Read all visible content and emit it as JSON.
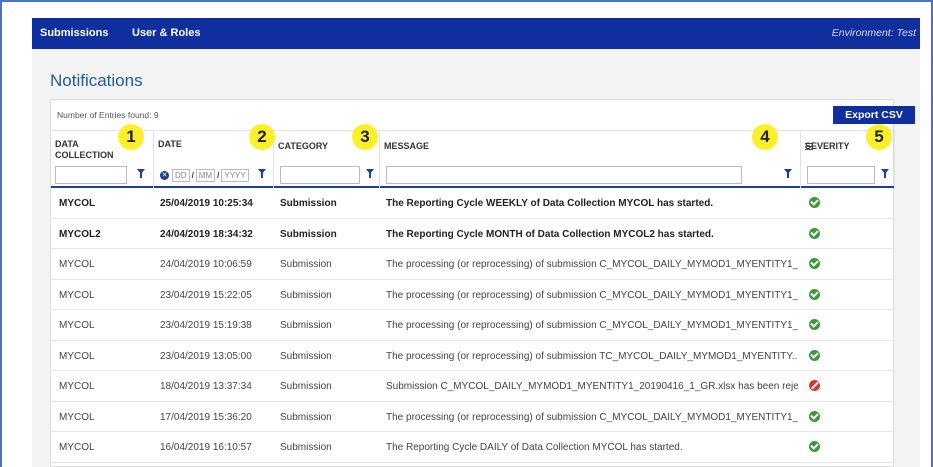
{
  "nav": {
    "items": [
      "Submissions",
      "User & Roles"
    ],
    "environment": "Environment: Test"
  },
  "page": {
    "title": "Notifications"
  },
  "table": {
    "entries_found": "Number of Entries found: 9",
    "export_label": "Export CSV",
    "columns": [
      "DATA COLLECTION",
      "DATE",
      "CATEGORY",
      "MESSAGE",
      "SEVERITY"
    ],
    "date_filter": {
      "dd": "DD",
      "mm": "MM",
      "yyyy": "YYYY"
    },
    "rows": [
      {
        "collection": "MYCOL",
        "date": "25/04/2019 10:25:34",
        "category": "Submission",
        "message": "The Reporting Cycle WEEKLY of Data Collection MYCOL has started.",
        "severity": "ok",
        "bold": true
      },
      {
        "collection": "MYCOL2",
        "date": "24/04/2019 18:34:32",
        "category": "Submission",
        "message": "The Reporting Cycle MONTH of Data Collection MYCOL2 has started.",
        "severity": "ok",
        "bold": true
      },
      {
        "collection": "MYCOL",
        "date": "24/04/2019 10:06:59",
        "category": "Submission",
        "message": "The processing (or reprocessing) of submission C_MYCOL_DAILY_MYMOD1_MYENTITY1_...",
        "severity": "ok",
        "bold": false
      },
      {
        "collection": "MYCOL",
        "date": "23/04/2019 15:22:05",
        "category": "Submission",
        "message": "The processing (or reprocessing) of submission C_MYCOL_DAILY_MYMOD1_MYENTITY1_...",
        "severity": "ok",
        "bold": false
      },
      {
        "collection": "MYCOL",
        "date": "23/04/2019 15:19:38",
        "category": "Submission",
        "message": "The processing (or reprocessing) of submission C_MYCOL_DAILY_MYMOD1_MYENTITY1_...",
        "severity": "ok",
        "bold": false
      },
      {
        "collection": "MYCOL",
        "date": "23/04/2019 13:05:00",
        "category": "Submission",
        "message": "The processing (or reprocessing) of submission TC_MYCOL_DAILY_MYMOD1_MYENTITY...",
        "severity": "ok",
        "bold": false
      },
      {
        "collection": "MYCOL",
        "date": "18/04/2019 13:37:34",
        "category": "Submission",
        "message": "Submission C_MYCOL_DAILY_MYMOD1_MYENTITY1_20190416_1_GR.xlsx has been rejec...",
        "severity": "error",
        "bold": false
      },
      {
        "collection": "MYCOL",
        "date": "17/04/2019 15:36:20",
        "category": "Submission",
        "message": "The processing (or reprocessing) of submission C_MYCOL_DAILY_MYMOD1_MYENTITY1_...",
        "severity": "ok",
        "bold": false
      },
      {
        "collection": "MYCOL",
        "date": "16/04/2019 16:10:57",
        "category": "Submission",
        "message": "The Reporting Cycle DAILY of Data Collection MYCOL has started.",
        "severity": "ok",
        "bold": false
      }
    ]
  },
  "callouts": [
    "1",
    "2",
    "3",
    "4",
    "5"
  ],
  "colors": {
    "nav_bg": "#0f2f9e",
    "title": "#1f5b9e",
    "callout": "#ffef2a",
    "ok": "#3a9a3a",
    "error": "#d8372e"
  }
}
